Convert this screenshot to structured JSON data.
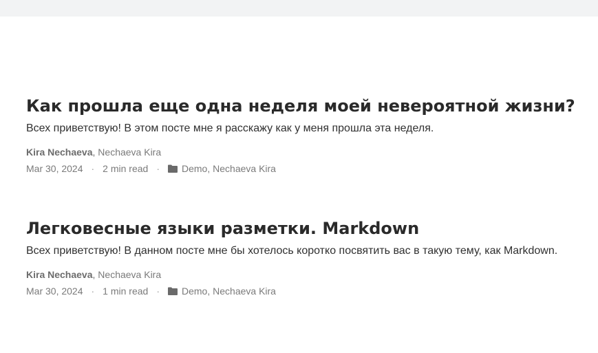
{
  "posts": [
    {
      "title": "Как прошла еще одна неделя моей невероятной жизни?",
      "excerpt": "Всех приветствую! В этом посте мне я расскажу как у меня прошла эта неделя.",
      "author_main": "Kira Nechaeva",
      "author_other": "Nechaeva Kira",
      "date": "Mar 30, 2024",
      "read_time": "2 min read",
      "categories": [
        "Demo",
        "Nechaeva Kira"
      ]
    },
    {
      "title": "Легковесные языки разметки. Markdown",
      "excerpt": "Всех приветствую! В данном посте мне бы хотелось коротко посвятить вас в такую тему, как Markdown.",
      "author_main": "Kira Nechaeva",
      "author_other": "Nechaeva Kira",
      "date": "Mar 30, 2024",
      "read_time": "1 min read",
      "categories": [
        "Demo",
        "Nechaeva Kira"
      ]
    }
  ],
  "separator": "·",
  "comma": ","
}
